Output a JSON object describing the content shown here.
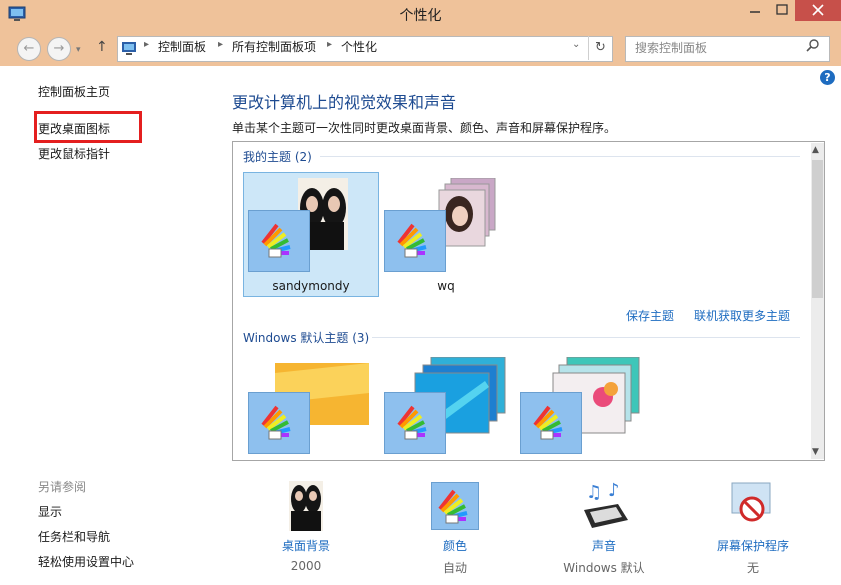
{
  "window": {
    "title": "个性化"
  },
  "address": {
    "root_icon": "control-panel-icon",
    "crumbs": [
      "控制面板",
      "所有控制面板项",
      "个性化"
    ]
  },
  "search": {
    "placeholder": "搜索控制面板"
  },
  "sidebar": {
    "home": "控制面板主页",
    "links": [
      "更改桌面图标",
      "更改鼠标指针"
    ],
    "see_also_title": "另请参阅",
    "see_also": [
      "显示",
      "任务栏和导航",
      "轻松使用设置中心"
    ]
  },
  "main": {
    "heading": "更改计算机上的视觉效果和声音",
    "description": "单击某个主题可一次性同时更改桌面背景、颜色、声音和屏幕保护程序。",
    "my_themes_title": "我的主题 (2)",
    "my_themes": [
      {
        "name": "sandymondy"
      },
      {
        "name": "wq"
      }
    ],
    "save_theme": "保存主题",
    "get_more": "联机获取更多主题",
    "windows_themes_title": "Windows 默认主题 (3)"
  },
  "bottom": [
    {
      "label": "桌面背景",
      "value": "2000",
      "icon": "desktop-background-icon"
    },
    {
      "label": "颜色",
      "value": "自动",
      "icon": "color-palette-icon"
    },
    {
      "label": "声音",
      "value": "Windows 默认",
      "icon": "sound-icon"
    },
    {
      "label": "屏幕保护程序",
      "value": "无",
      "icon": "screensaver-icon"
    }
  ],
  "colors": {
    "titlebar": "#efc29a",
    "accent_link": "#1e6cc0",
    "heading": "#1e4b91",
    "highlight": "#e41f1f"
  }
}
